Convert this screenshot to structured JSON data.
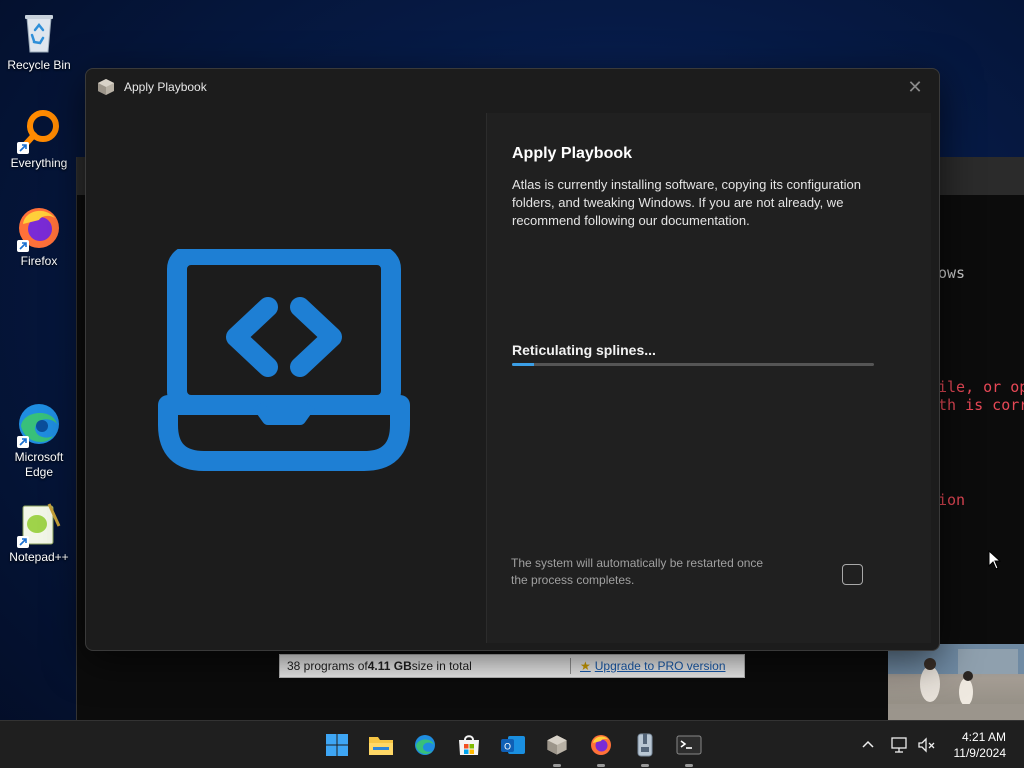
{
  "desktop": {
    "icons": [
      {
        "label": "Recycle Bin",
        "icon": "recycle-bin-icon"
      },
      {
        "label": "Everything",
        "icon": "everything-search-icon"
      },
      {
        "label": "Firefox",
        "icon": "firefox-icon"
      },
      {
        "label": "Microsoft Edge",
        "icon": "edge-icon"
      },
      {
        "label": "Notepad++",
        "icon": "notepadpp-icon"
      }
    ]
  },
  "background": {
    "terminal_lines": [
      {
        "text": "ows",
        "color": "#cccccc"
      },
      {
        "text": "ile, or op",
        "color": "#e74856"
      },
      {
        "text": "th is corr",
        "color": "#e74856"
      },
      {
        "text": "ion",
        "color": "#e74856"
      }
    ],
    "status_bar": {
      "count_prefix": "38 programs of ",
      "size": "4.11 GB",
      "size_suffix": " size in total",
      "upgrade_link": "Upgrade to PRO version"
    }
  },
  "dialog": {
    "title": "Apply Playbook",
    "heading": "Apply Playbook",
    "description": "Atlas is currently installing software, copying its configuration folders, and tweaking Windows. If you are not already, we recommend following our documentation.",
    "progress_label": "Reticulating splines...",
    "progress_fraction": 0.06,
    "restart_note": "The system will automatically be restarted once the process completes.",
    "restart_checked": false,
    "accent_color": "#1e7fd4"
  },
  "taskbar": {
    "apps": [
      "windows-start-icon",
      "file-explorer-icon",
      "edge-icon",
      "microsoft-store-icon",
      "outlook-icon",
      "atlas-box-icon",
      "firefox-icon",
      "archive-icon",
      "terminal-icon"
    ],
    "time": "4:21 AM",
    "date": "11/9/2024"
  }
}
